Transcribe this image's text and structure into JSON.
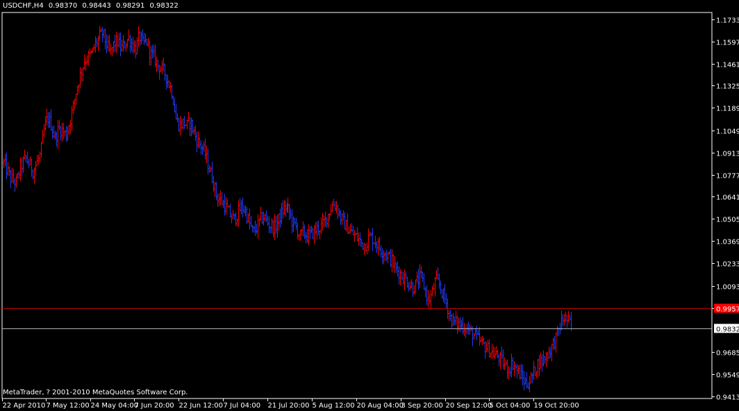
{
  "header": {
    "symbol": "USDCHF,H4",
    "open": "0.98370",
    "high": "0.98443",
    "low": "0.98291",
    "close": "0.98322"
  },
  "footer": {
    "copyright": "MetaTrader, ? 2001-2010 MetaQuotes Software Corp."
  },
  "colors": {
    "background": "#000000",
    "axis": "#ffffff",
    "bull": "#ff0000",
    "bear": "#1e3cff",
    "ask_line": "#c00000",
    "bid_line": "#b0b0b0",
    "ask_label_bg": "#ff0000",
    "bid_label_bg": "#ffffff"
  },
  "chart_data": {
    "type": "candlestick",
    "grid": false,
    "ylim": [
      0.94,
      1.1775
    ],
    "y_ticks": [
      {
        "label": "1.17330",
        "value": 1.1733
      },
      {
        "label": "1.15970",
        "value": 1.1597
      },
      {
        "label": "1.14610",
        "value": 1.1461
      },
      {
        "label": "1.13250",
        "value": 1.1325
      },
      {
        "label": "1.11890",
        "value": 1.1189
      },
      {
        "label": "1.10490",
        "value": 1.1049
      },
      {
        "label": "1.09130",
        "value": 1.0913
      },
      {
        "label": "1.07770",
        "value": 1.0777
      },
      {
        "label": "1.06410",
        "value": 1.0641
      },
      {
        "label": "1.05050",
        "value": 1.0505
      },
      {
        "label": "1.03690",
        "value": 1.0369
      },
      {
        "label": "1.02330",
        "value": 1.0233
      },
      {
        "label": "1.00930",
        "value": 1.0093
      },
      {
        "label": "0.99570",
        "value": 0.9957
      },
      {
        "label": "0.96850",
        "value": 0.9685
      },
      {
        "label": "0.95490",
        "value": 0.9549
      },
      {
        "label": "0.94130",
        "value": 0.9413
      }
    ],
    "x_ticks": [
      "22 Apr 2010",
      "7 May 12:00",
      "24 May 04:00",
      "7 Jun 20:00",
      "22 Jun 12:00",
      "7 Jul 04:00",
      "21 Jul 20:00",
      "5 Aug 12:00",
      "20 Aug 04:00",
      "3 Sep 20:00",
      "20 Sep 12:00",
      "5 Oct 04:00",
      "19 Oct 20:00"
    ],
    "bars": 410,
    "ask_level": 0.9957,
    "ask_label": "0.99570",
    "bid_level": 0.98322,
    "bid_label": "0.98322",
    "path": [
      [
        0,
        1.085
      ],
      [
        4,
        1.075
      ],
      [
        7,
        1.073
      ],
      [
        9,
        1.082
      ],
      [
        12,
        1.088
      ],
      [
        14,
        1.084
      ],
      [
        16,
        1.08
      ],
      [
        18,
        1.085
      ],
      [
        20,
        1.09
      ],
      [
        22,
        1.105
      ],
      [
        24,
        1.113
      ],
      [
        26,
        1.108
      ],
      [
        28,
        1.1
      ],
      [
        30,
        1.106
      ],
      [
        32,
        1.105
      ],
      [
        34,
        1.102
      ],
      [
        36,
        1.11
      ],
      [
        38,
        1.12
      ],
      [
        40,
        1.132
      ],
      [
        42,
        1.14
      ],
      [
        44,
        1.148
      ],
      [
        46,
        1.15
      ],
      [
        48,
        1.152
      ],
      [
        50,
        1.158
      ],
      [
        52,
        1.162
      ],
      [
        54,
        1.165
      ],
      [
        56,
        1.158
      ],
      [
        58,
        1.152
      ],
      [
        60,
        1.158
      ],
      [
        62,
        1.16
      ],
      [
        64,
        1.155
      ],
      [
        66,
        1.158
      ],
      [
        68,
        1.162
      ],
      [
        70,
        1.158
      ],
      [
        72,
        1.155
      ],
      [
        74,
        1.163
      ],
      [
        76,
        1.158
      ],
      [
        78,
        1.16
      ],
      [
        80,
        1.152
      ],
      [
        82,
        1.15
      ],
      [
        84,
        1.145
      ],
      [
        86,
        1.143
      ],
      [
        88,
        1.14
      ],
      [
        90,
        1.134
      ],
      [
        92,
        1.128
      ],
      [
        94,
        1.112
      ],
      [
        96,
        1.108
      ],
      [
        98,
        1.11
      ],
      [
        100,
        1.108
      ],
      [
        102,
        1.11
      ],
      [
        104,
        1.103
      ],
      [
        106,
        1.098
      ],
      [
        108,
        1.095
      ],
      [
        110,
        1.09
      ],
      [
        112,
        1.082
      ],
      [
        114,
        1.075
      ],
      [
        116,
        1.065
      ],
      [
        118,
        1.062
      ],
      [
        120,
        1.06
      ],
      [
        122,
        1.056
      ],
      [
        124,
        1.052
      ],
      [
        126,
        1.05
      ],
      [
        128,
        1.055
      ],
      [
        130,
        1.058
      ],
      [
        132,
        1.055
      ],
      [
        134,
        1.048
      ],
      [
        136,
        1.042
      ],
      [
        138,
        1.045
      ],
      [
        140,
        1.05
      ],
      [
        142,
        1.052
      ],
      [
        144,
        1.048
      ],
      [
        146,
        1.046
      ],
      [
        148,
        1.045
      ],
      [
        150,
        1.05
      ],
      [
        152,
        1.055
      ],
      [
        154,
        1.058
      ],
      [
        156,
        1.055
      ],
      [
        158,
        1.048
      ],
      [
        160,
        1.045
      ],
      [
        162,
        1.04
      ],
      [
        164,
        1.042
      ],
      [
        166,
        1.04
      ],
      [
        168,
        1.041
      ],
      [
        170,
        1.043
      ],
      [
        172,
        1.045
      ],
      [
        174,
        1.046
      ],
      [
        176,
        1.05
      ],
      [
        178,
        1.055
      ],
      [
        180,
        1.06
      ],
      [
        182,
        1.058
      ],
      [
        184,
        1.052
      ],
      [
        186,
        1.048
      ],
      [
        188,
        1.045
      ],
      [
        190,
        1.042
      ],
      [
        192,
        1.04
      ],
      [
        194,
        1.038
      ],
      [
        196,
        1.035
      ],
      [
        198,
        1.035
      ],
      [
        200,
        1.04
      ],
      [
        202,
        1.038
      ],
      [
        204,
        1.035
      ],
      [
        206,
        1.032
      ],
      [
        208,
        1.03
      ],
      [
        210,
        1.028
      ],
      [
        212,
        1.025
      ],
      [
        214,
        1.02
      ],
      [
        216,
        1.018
      ],
      [
        218,
        1.015
      ],
      [
        220,
        1.013
      ],
      [
        222,
        1.01
      ],
      [
        224,
        1.008
      ],
      [
        226,
        1.012
      ],
      [
        228,
        1.015
      ],
      [
        230,
        1.008
      ],
      [
        232,
        1.0
      ],
      [
        234,
        1.004
      ],
      [
        236,
        1.013
      ],
      [
        238,
        1.01
      ],
      [
        240,
        1.004
      ],
      [
        242,
        0.998
      ],
      [
        244,
        0.99
      ],
      [
        246,
        0.987
      ],
      [
        248,
        0.986
      ],
      [
        250,
        0.985
      ],
      [
        252,
        0.984
      ],
      [
        254,
        0.982
      ],
      [
        256,
        0.98
      ],
      [
        258,
        0.978
      ],
      [
        260,
        0.975
      ],
      [
        262,
        0.973
      ],
      [
        264,
        0.971
      ],
      [
        266,
        0.969
      ],
      [
        268,
        0.967
      ],
      [
        270,
        0.966
      ],
      [
        272,
        0.963
      ],
      [
        274,
        0.96
      ],
      [
        276,
        0.958
      ],
      [
        278,
        0.962
      ],
      [
        280,
        0.958
      ],
      [
        282,
        0.955
      ],
      [
        284,
        0.951
      ],
      [
        286,
        0.949
      ],
      [
        288,
        0.952
      ],
      [
        290,
        0.957
      ],
      [
        292,
        0.962
      ],
      [
        294,
        0.963
      ],
      [
        296,
        0.966
      ],
      [
        298,
        0.969
      ],
      [
        300,
        0.973
      ],
      [
        302,
        0.978
      ],
      [
        304,
        0.985
      ],
      [
        306,
        0.99
      ],
      [
        308,
        0.988
      ],
      [
        310,
        0.985
      ]
    ]
  }
}
